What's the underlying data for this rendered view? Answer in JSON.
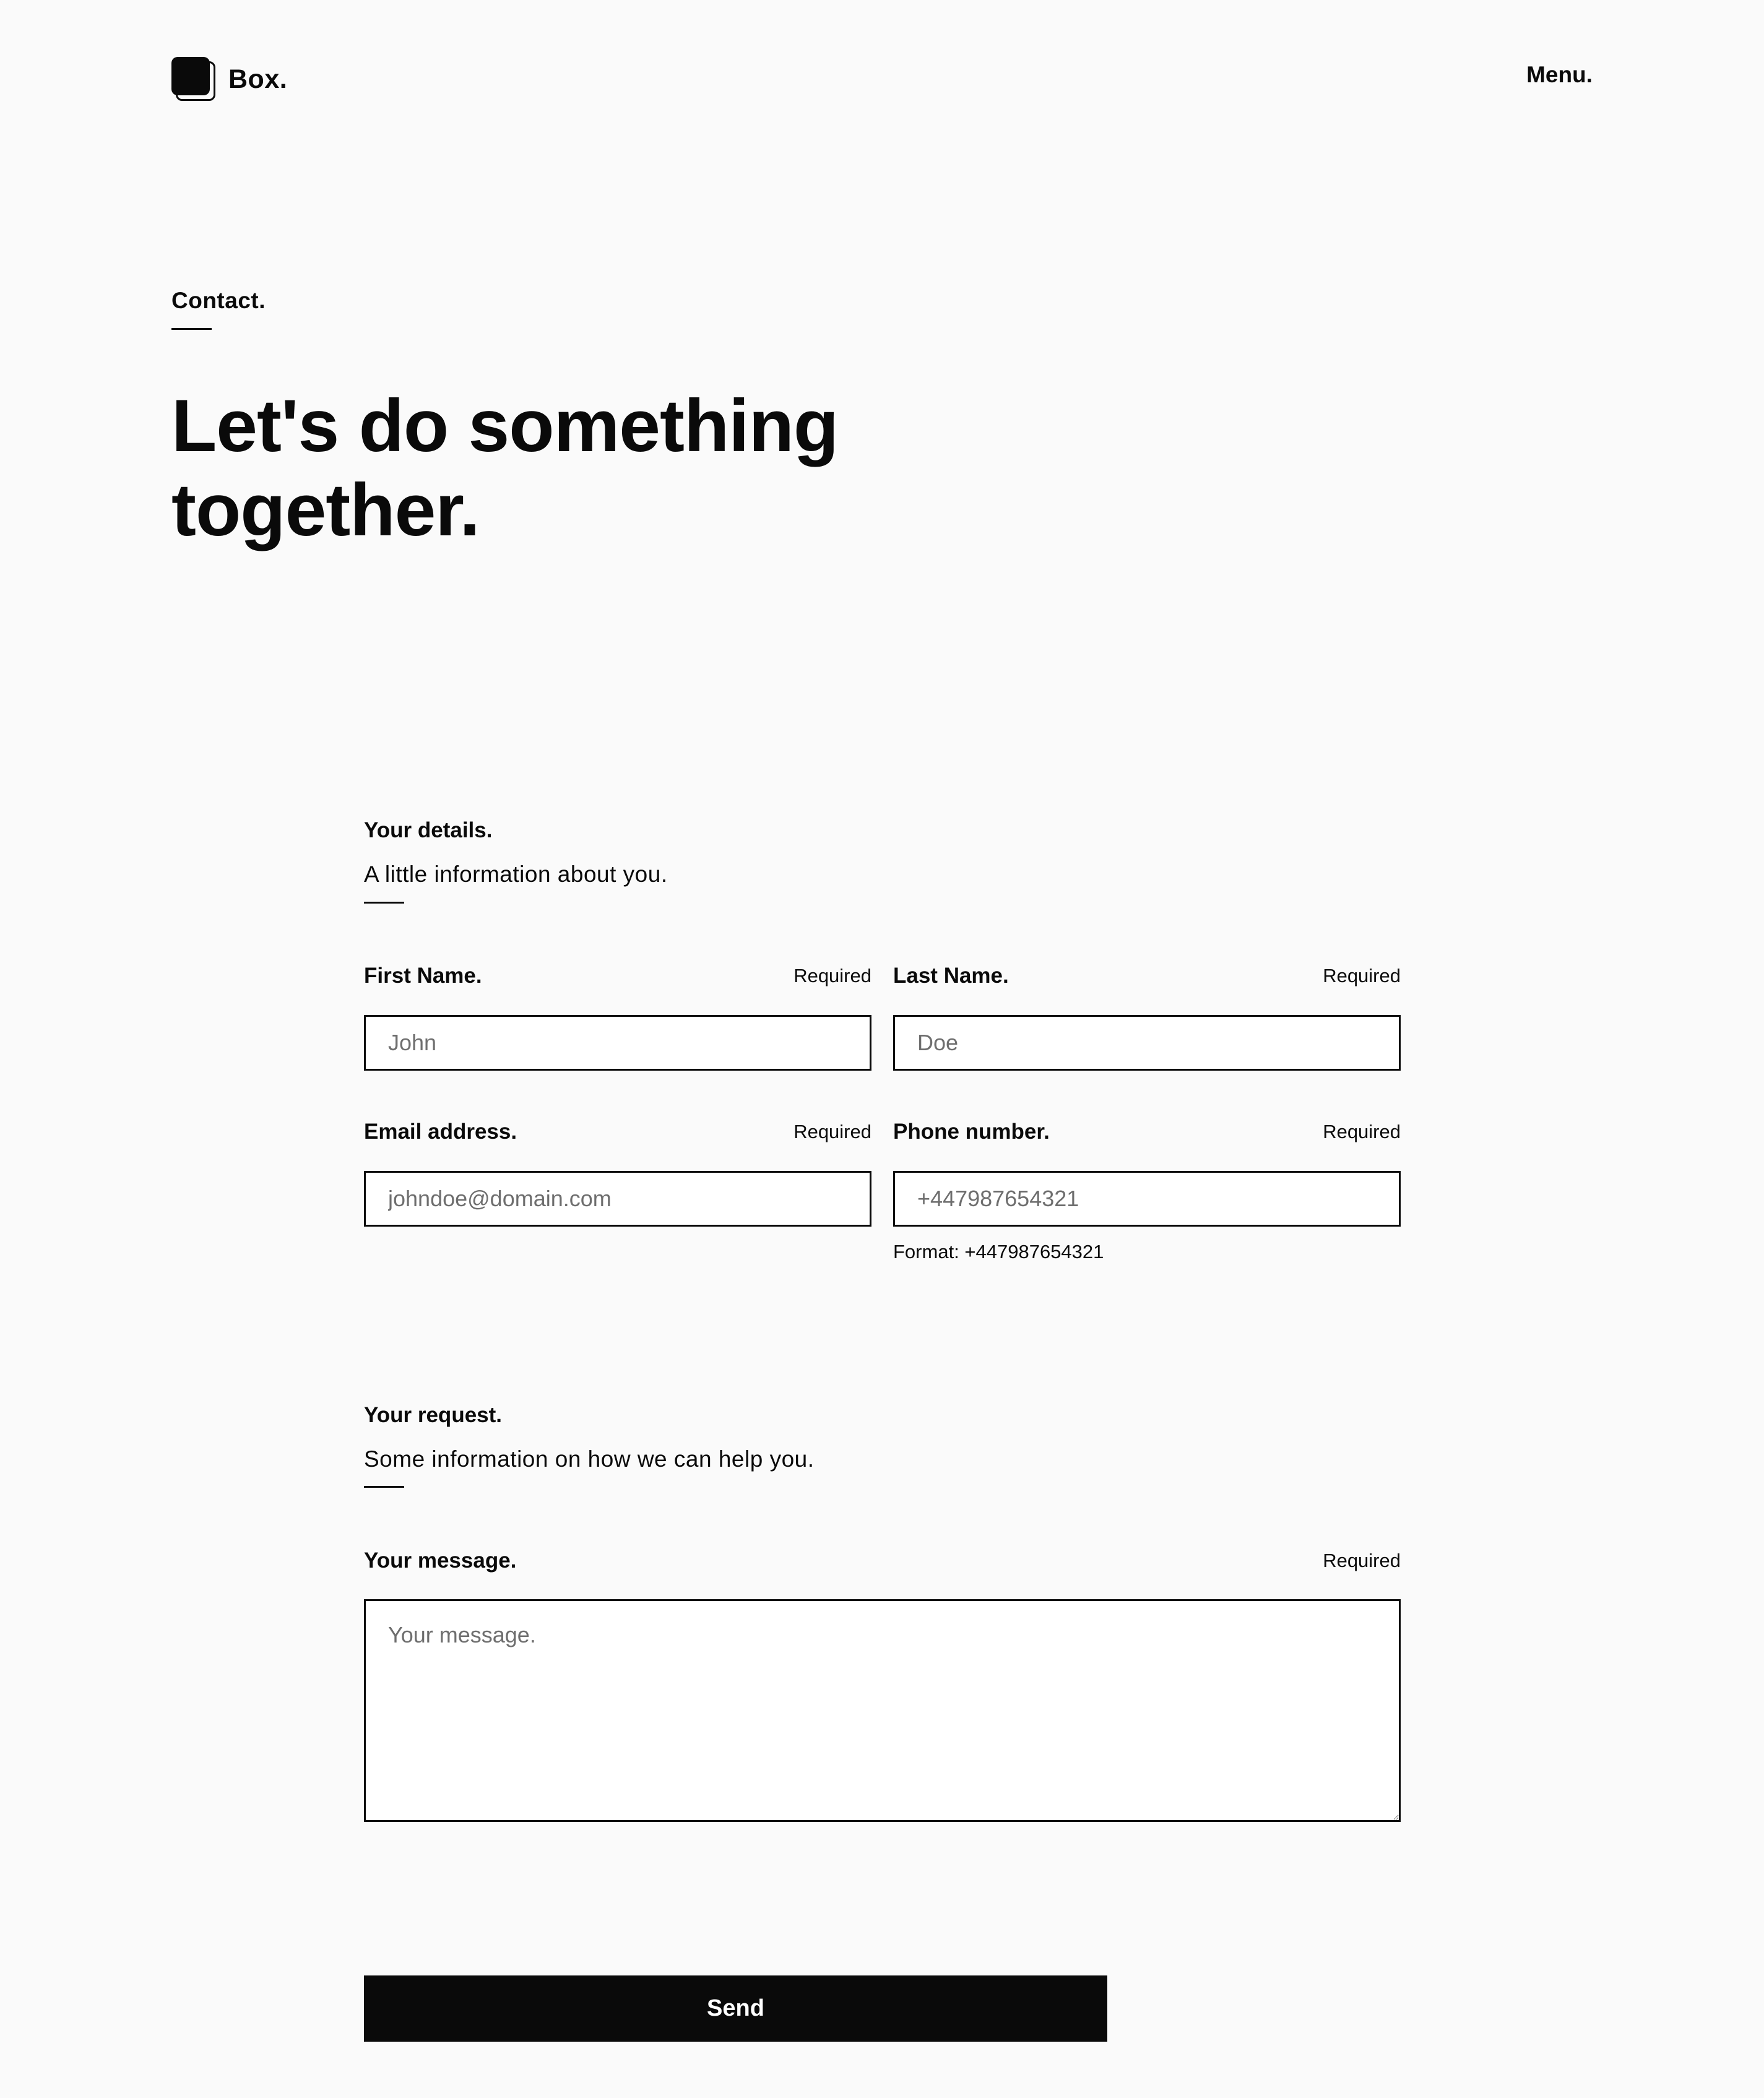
{
  "brand": {
    "name": "Box.",
    "logo_icon": "stacked-square-icon"
  },
  "nav": {
    "menu_label": "Menu."
  },
  "hero": {
    "eyebrow": "Contact.",
    "title_line1": "Let's do something",
    "title_line2": "together."
  },
  "details_section": {
    "title": "Your details.",
    "subtitle": "A little information about you."
  },
  "fields": {
    "first_name": {
      "label": "First Name.",
      "required": "Required",
      "placeholder": "John",
      "value": ""
    },
    "last_name": {
      "label": "Last Name.",
      "required": "Required",
      "placeholder": "Doe",
      "value": ""
    },
    "email": {
      "label": "Email address.",
      "required": "Required",
      "placeholder": "johndoe@domain.com",
      "value": ""
    },
    "phone": {
      "label": "Phone number.",
      "required": "Required",
      "placeholder": "+447987654321",
      "value": "",
      "hint": "Format: +447987654321"
    },
    "message": {
      "label": "Your message.",
      "required": "Required",
      "placeholder": "Your message.",
      "value": ""
    }
  },
  "request_section": {
    "title": "Your request.",
    "subtitle": "Some information on how we can help you."
  },
  "submit": {
    "label": "Send"
  },
  "colors": {
    "background": "#fafafa",
    "ink": "#0a0a0a",
    "input_bg": "#ffffff",
    "placeholder": "#6e6e6e"
  }
}
